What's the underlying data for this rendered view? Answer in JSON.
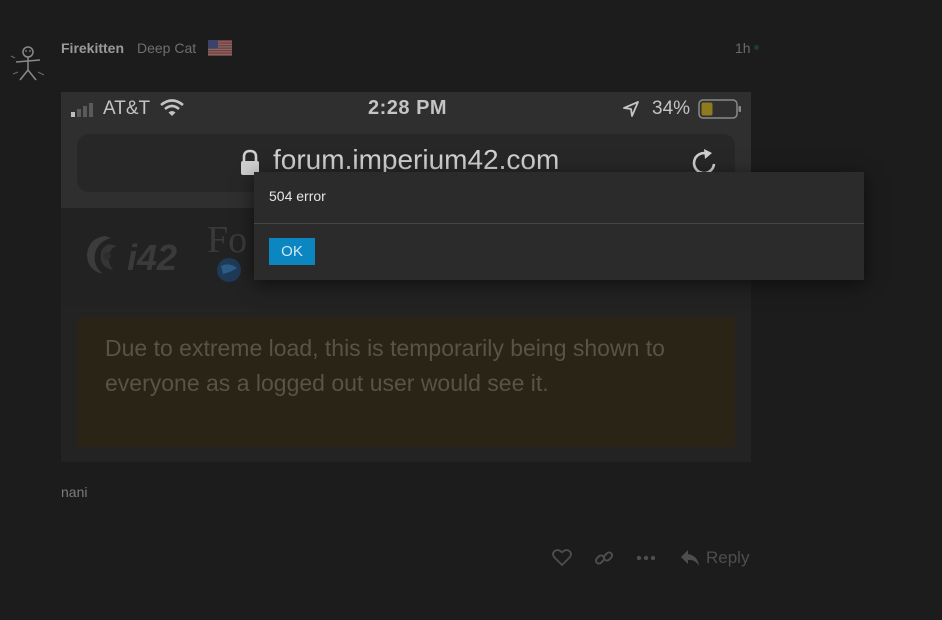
{
  "post": {
    "username": "Firekitten",
    "user_title": "Deep Cat",
    "time": "1h",
    "body": "nani",
    "flag_icon": "us-flag-icon"
  },
  "screenshot": {
    "carrier": "AT&T",
    "clock": "2:28 PM",
    "battery": "34%",
    "url": "forum.imperium42.com",
    "logo_text": "i42",
    "forum_word": "Fo",
    "notice": "Due to extreme load, this is temporarily being shown to everyone as a logged out user would see it."
  },
  "actions": {
    "reply_label": "Reply"
  },
  "dialog": {
    "message": "504 error",
    "ok_label": "OK"
  },
  "colors": {
    "background": "#1c1c1c",
    "dialog_background": "#2b2b2b",
    "ok_button": "#0b86c0"
  }
}
